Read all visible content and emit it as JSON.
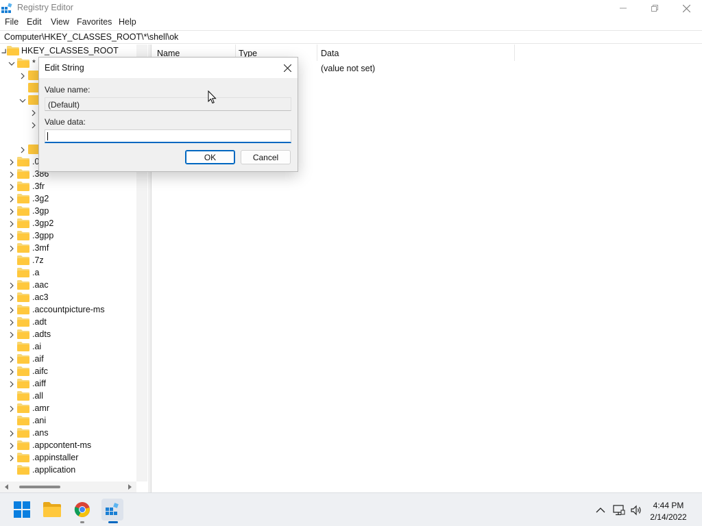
{
  "window": {
    "title": "Registry Editor",
    "icon": "registry-icon"
  },
  "menu": {
    "items": [
      "File",
      "Edit",
      "View",
      "Favorites",
      "Help"
    ]
  },
  "address": {
    "path": "Computer\\HKEY_CLASSES_ROOT\\*\\shell\\ok"
  },
  "tree": {
    "root": "HKEY_CLASSES_ROOT",
    "star_key": "*",
    "partial_key": ".0",
    "items": [
      ".386",
      ".3fr",
      ".3g2",
      ".3gp",
      ".3gp2",
      ".3gpp",
      ".3mf",
      ".7z",
      ".a",
      ".aac",
      ".ac3",
      ".accountpicture-ms",
      ".adt",
      ".adts",
      ".ai",
      ".aif",
      ".aifc",
      ".aiff",
      ".all",
      ".amr",
      ".ani",
      ".ans",
      ".appcontent-ms",
      ".appinstaller",
      ".application"
    ]
  },
  "list": {
    "columns": [
      "Name",
      "Type",
      "Data"
    ],
    "rows": [
      {
        "name": "",
        "type": "",
        "data": "(value not set)"
      }
    ]
  },
  "dialog": {
    "title": "Edit String",
    "value_name_label": "Value name:",
    "value_name": "(Default)",
    "value_data_label": "Value data:",
    "value_data": "",
    "ok_label": "OK",
    "cancel_label": "Cancel"
  },
  "taskbar": {
    "apps": [
      "start-icon",
      "file-explorer-icon",
      "chrome-icon",
      "registry-editor-icon"
    ],
    "tray_icons": [
      "chevron-up-icon",
      "network-icon",
      "volume-icon"
    ],
    "time": "4:44 PM",
    "date": "2/14/2022"
  },
  "colors": {
    "accent": "#0067c0",
    "folder": "#f8d775",
    "taskbar": "#eef0f3"
  }
}
